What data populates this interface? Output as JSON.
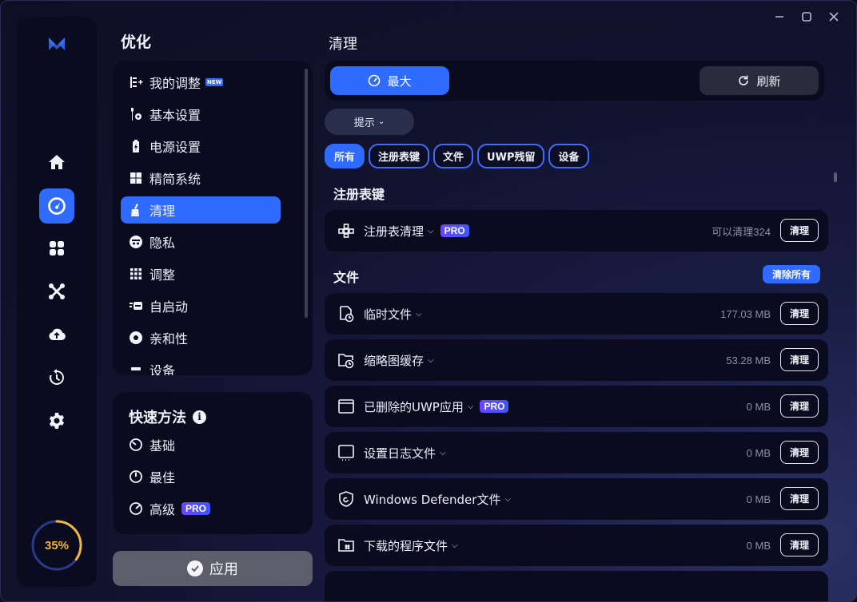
{
  "window": {
    "minimize": "minimize",
    "maximize": "maximize",
    "close": "close"
  },
  "rail": {
    "items": [
      "home-icon",
      "dashboard-icon",
      "apps-icon",
      "tools-icon",
      "cloud-upload-icon",
      "history-icon",
      "settings-icon"
    ],
    "active_index": 1,
    "gauge": {
      "value_text": "35%",
      "fraction": 0.35,
      "color": "#f2b63a"
    }
  },
  "optimize": {
    "title": "优化",
    "nav": [
      {
        "label": "我的调整",
        "badge": "NEW"
      },
      {
        "label": "基本设置"
      },
      {
        "label": "电源设置"
      },
      {
        "label": "精简系统"
      },
      {
        "label": "清理"
      },
      {
        "label": "隐私"
      },
      {
        "label": "调整"
      },
      {
        "label": "自启动"
      },
      {
        "label": "亲和性"
      },
      {
        "label": "设备"
      }
    ],
    "active_index": 4
  },
  "quick": {
    "title": "快速方法",
    "info": "i",
    "items": [
      {
        "label": "基础"
      },
      {
        "label": "最佳"
      },
      {
        "label": "高级",
        "badge": "PRO"
      }
    ]
  },
  "apply": {
    "label": "应用"
  },
  "clean": {
    "title": "清理",
    "mode_max": "最大",
    "mode_refresh": "刷新",
    "hint": "提示",
    "filters": [
      "所有",
      "注册表键",
      "文件",
      "UWP残留",
      "设备"
    ],
    "active_filter": 0,
    "registry_group": "注册表键",
    "files_group": "文件",
    "clear_all": "清除所有",
    "registry_rows": [
      {
        "label": "注册表清理",
        "badge": "PRO",
        "value": "可以清理324",
        "button": "清理"
      }
    ],
    "file_rows": [
      {
        "label": "临时文件",
        "value": "177.03 MB",
        "button": "清理"
      },
      {
        "label": "缩略图缓存",
        "value": "53.28 MB",
        "button": "清理"
      },
      {
        "label": "已删除的UWP应用",
        "badge": "PRO",
        "value": "0 MB",
        "button": "清理"
      },
      {
        "label": "设置日志文件",
        "value": "0 MB",
        "button": "清理"
      },
      {
        "label": "Windows Defender文件",
        "value": "0 MB",
        "button": "清理"
      },
      {
        "label": "下载的程序文件",
        "value": "0 MB",
        "button": "清理"
      }
    ]
  },
  "colors": {
    "accent": "#2f6bff",
    "pro": "#5b4cff",
    "gauge": "#f2b63a"
  }
}
